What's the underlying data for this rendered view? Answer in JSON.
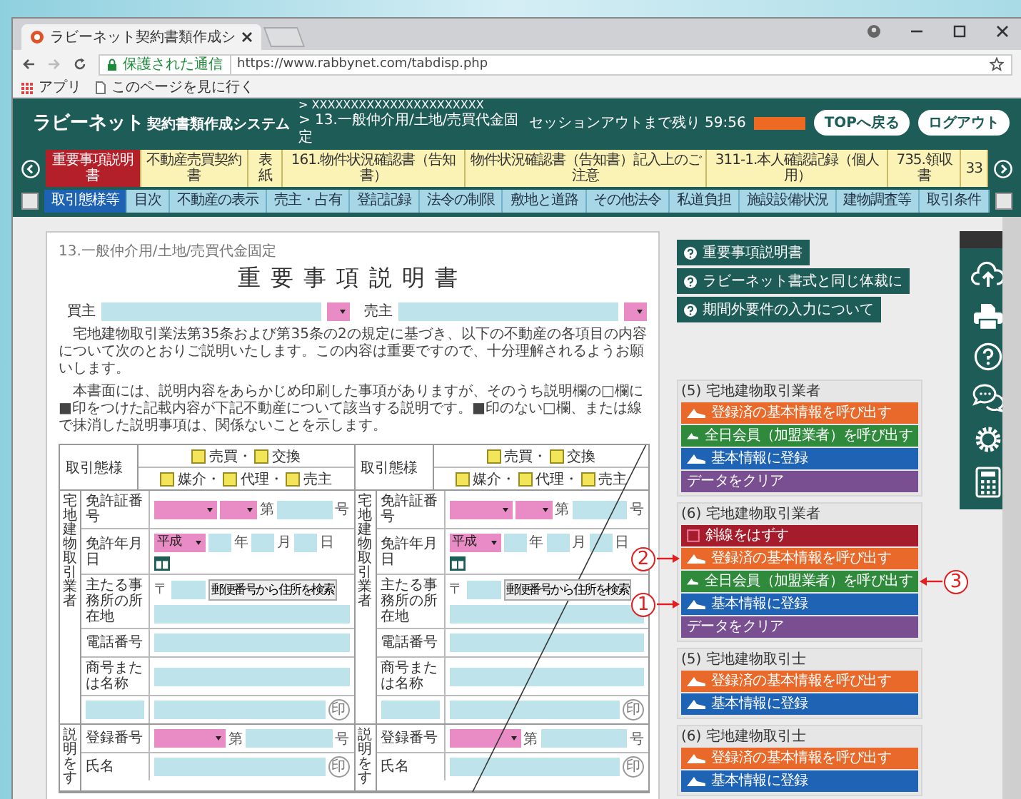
{
  "browser": {
    "tab_title": "ラビーネット契約書類作成シ",
    "security": "保護された通信",
    "url": "https://www.rabbynet.com/tabdisp.php",
    "bookmarks": [
      "アプリ",
      "このページを見に行く"
    ]
  },
  "header": {
    "logo": "ラビーネット",
    "logo_sub": "契約書類作成システム",
    "breadcrumb": [
      "> XXXXXXXXXXXXXXXXXXXXXX",
      "> 13.一般仲介用/土地/売買代金固定"
    ],
    "session_text": "セッションアウトまで残り 59:56",
    "session_meter": {
      "level": 1
    },
    "buttons": [
      "TOPへ戻る",
      "ログアウト"
    ]
  },
  "document_tabs": [
    {
      "label": "重要事項説明書",
      "selected": true
    },
    {
      "label": "不動産売買契約書",
      "selected": false
    },
    {
      "label": "表紙",
      "selected": false
    },
    {
      "label": "161.物件状況確認書（告知書）",
      "selected": false
    },
    {
      "label": "物件状況確認書（告知書）記入上のご注意",
      "selected": false
    },
    {
      "label": "311-1.本人確認記録（個人用）",
      "selected": false
    },
    {
      "label": "735.領収書",
      "selected": false
    },
    {
      "label": "33",
      "selected": false
    }
  ],
  "section_tabs": [
    {
      "label": "取引態様等",
      "selected": true
    },
    {
      "label": "目次",
      "selected": false
    },
    {
      "label": "不動産の表示",
      "selected": false
    },
    {
      "label": "売主・占有",
      "selected": false
    },
    {
      "label": "登記記録",
      "selected": false
    },
    {
      "label": "法令の制限",
      "selected": false
    },
    {
      "label": "敷地と道路",
      "selected": false
    },
    {
      "label": "その他法令",
      "selected": false
    },
    {
      "label": "私道負担",
      "selected": false
    },
    {
      "label": "施設設備状況",
      "selected": false
    },
    {
      "label": "建物調査等",
      "selected": false
    },
    {
      "label": "取引条件",
      "selected": false
    }
  ],
  "document": {
    "form_code": "13.一般仲介用/土地/売買代金固定",
    "title": "重要事項説明書",
    "parties": [
      {
        "label": "買主"
      },
      {
        "label": "売主"
      }
    ],
    "paragraphs": [
      "宅地建物取引業法第35条および第35条の2の規定に基づき、以下の不動産の各項目の内容について次のとおりご説明いたします。この内容は重要ですので、十分理解されるようお願いします。",
      "本書面には、説明内容をあらかじめ印刷した事項がありますが、そのうち説明欄の□欄に■印をつけた記載内容が下記不動産について該当する説明です。■印のない□欄、または線で抹消した説明事項は、関係ないことを示します。"
    ],
    "sides": [
      {
        "struck": false,
        "deal_label": "取引態様",
        "options": [
          [
            {
              "label": "売買・",
              "checked": false
            },
            {
              "label": "交換",
              "checked": false
            }
          ],
          [
            {
              "label": "媒介・",
              "checked": false
            },
            {
              "label": "代理・",
              "checked": false
            },
            {
              "label": "売主",
              "checked": false
            }
          ]
        ],
        "sections": [
          {
            "vertical": "宅地建物取引業者",
            "rows": [
              {
                "kind": "license",
                "label": "免許証番号",
                "before": "第",
                "after": "号"
              },
              {
                "kind": "date",
                "label": "免許年月日",
                "era": "平成",
                "units": [
                  "年",
                  "月",
                  "日"
                ]
              },
              {
                "kind": "address",
                "label": "主たる事務所の所在地",
                "zip": "〒",
                "search_button": "郵便番号から住所を検索"
              },
              {
                "kind": "text",
                "label": "電話番号"
              },
              {
                "kind": "text",
                "label": "商号または名称"
              },
              {
                "kind": "seal",
                "seal": "印"
              }
            ]
          },
          {
            "vertical": "説明をす",
            "rows": [
              {
                "kind": "registration",
                "label": "登録番号",
                "before": "第",
                "after": "号"
              },
              {
                "kind": "name",
                "label": "氏名",
                "seal": "印"
              }
            ]
          }
        ]
      },
      {
        "struck": true,
        "deal_label": "取引態様",
        "options": [
          [
            {
              "label": "売買・",
              "checked": false
            },
            {
              "label": "交換",
              "checked": false
            }
          ],
          [
            {
              "label": "媒介・",
              "checked": false
            },
            {
              "label": "代理・",
              "checked": false
            },
            {
              "label": "売主",
              "checked": false
            }
          ]
        ],
        "sections": [
          {
            "vertical": "宅地建物取引業者",
            "rows": [
              {
                "kind": "license",
                "label": "免許証番号",
                "before": "第",
                "after": "号"
              },
              {
                "kind": "date",
                "label": "免許年月日",
                "era": "平成",
                "units": [
                  "年",
                  "月",
                  "日"
                ]
              },
              {
                "kind": "address",
                "label": "主たる事務所の所在地",
                "zip": "〒",
                "search_button": "郵便番号から住所を検索"
              },
              {
                "kind": "text",
                "label": "電話番号"
              },
              {
                "kind": "text",
                "label": "商号または名称"
              },
              {
                "kind": "seal",
                "seal": "印"
              }
            ]
          },
          {
            "vertical": "説明をす",
            "rows": [
              {
                "kind": "registration",
                "label": "登録番号",
                "before": "第",
                "after": "号"
              },
              {
                "kind": "name",
                "label": "氏名",
                "seal": "印"
              }
            ]
          }
        ]
      }
    ]
  },
  "help_links": [
    "重要事項説明書",
    "ラビーネット書式と同じ体裁に",
    "期間外要件の入力について"
  ],
  "action_groups": [
    {
      "heading": "(5) 宅地建物取引業者",
      "buttons": [
        {
          "kind": "recall",
          "label": "登録済の基本情報を呼び出す"
        },
        {
          "kind": "member",
          "label": "全日会員（加盟業者）を呼び出す"
        },
        {
          "kind": "register",
          "label": "基本情報に登録"
        },
        {
          "kind": "clear",
          "label": "データをクリア"
        }
      ]
    },
    {
      "heading": "(6) 宅地建物取引業者",
      "buttons": [
        {
          "kind": "unstrike",
          "label": "斜線をはずす"
        },
        {
          "kind": "recall",
          "label": "登録済の基本情報を呼び出す",
          "callout": "2"
        },
        {
          "kind": "member",
          "label": "全日会員（加盟業者）を呼び出す",
          "callout": "3"
        },
        {
          "kind": "register",
          "label": "基本情報に登録",
          "callout": "1"
        },
        {
          "kind": "clear",
          "label": "データをクリア"
        }
      ]
    },
    {
      "heading": "(5) 宅地建物取引士",
      "buttons": [
        {
          "kind": "recall",
          "label": "登録済の基本情報を呼び出す"
        },
        {
          "kind": "register",
          "label": "基本情報に登録"
        }
      ]
    },
    {
      "heading": "(6) 宅地建物取引士",
      "buttons": [
        {
          "kind": "recall",
          "label": "登録済の基本情報を呼び出す"
        },
        {
          "kind": "register",
          "label": "基本情報に登録"
        }
      ]
    }
  ]
}
